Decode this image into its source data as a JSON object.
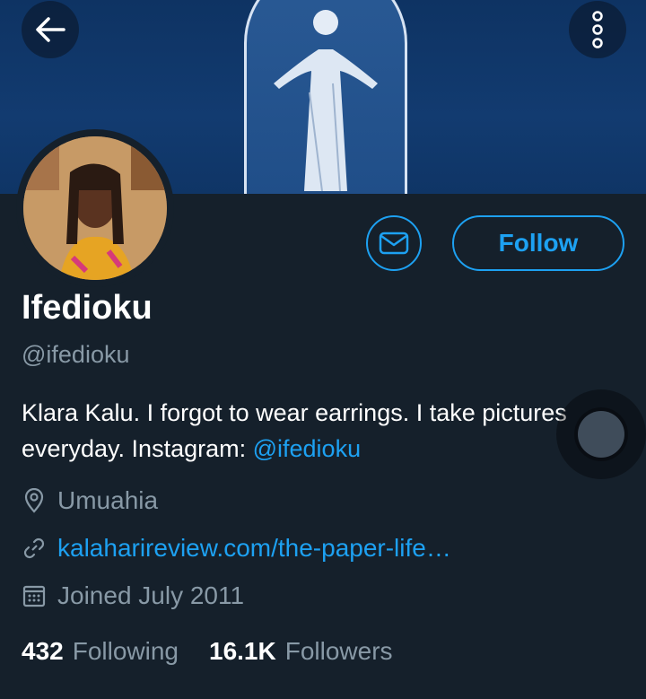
{
  "header": {
    "back_icon": "arrow-left-icon",
    "more_icon": "more-vertical-icon"
  },
  "profile": {
    "name": "Ifedioku",
    "handle": "@ifedioku",
    "bio_text": "Klara Kalu. I forgot to wear earrings. I take pictures everyday. Instagram: ",
    "bio_mention": "@ifedioku",
    "location": "Umuahia",
    "website": "kalaharireview.com/the-paper-life…",
    "joined": "Joined July 2011"
  },
  "actions": {
    "follow_label": "Follow",
    "message_icon": "envelope-icon"
  },
  "stats": {
    "following_count": "432",
    "following_label": "Following",
    "followers_count": "16.1K",
    "followers_label": "Followers"
  },
  "colors": {
    "background": "#15202b",
    "accent": "#1da1f2",
    "secondary_text": "#8899a6"
  }
}
